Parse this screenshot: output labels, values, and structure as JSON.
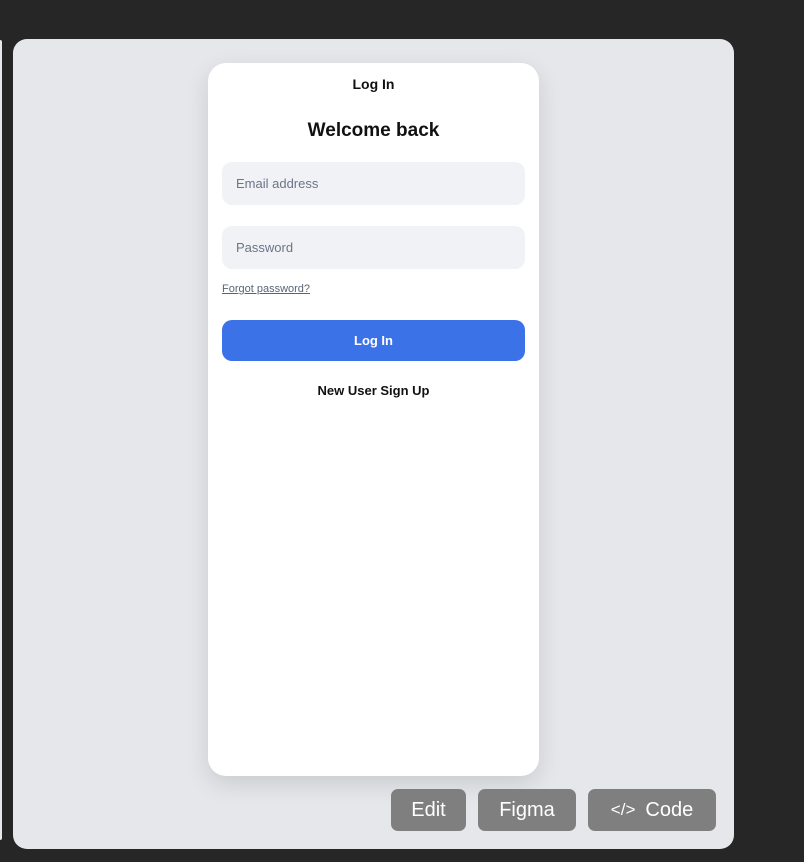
{
  "card": {
    "title": "Log In",
    "heading": "Welcome back",
    "email_placeholder": "Email address",
    "password_placeholder": "Password",
    "forgot_link": "Forgot password?",
    "login_button": "Log In",
    "signup_link": "New User Sign Up"
  },
  "toolbar": {
    "edit": "Edit",
    "figma": "Figma",
    "code": "Code",
    "code_icon": "</>"
  },
  "colors": {
    "accent": "#3b72e8",
    "panel": "#e5e7eb",
    "background": "#262626"
  }
}
